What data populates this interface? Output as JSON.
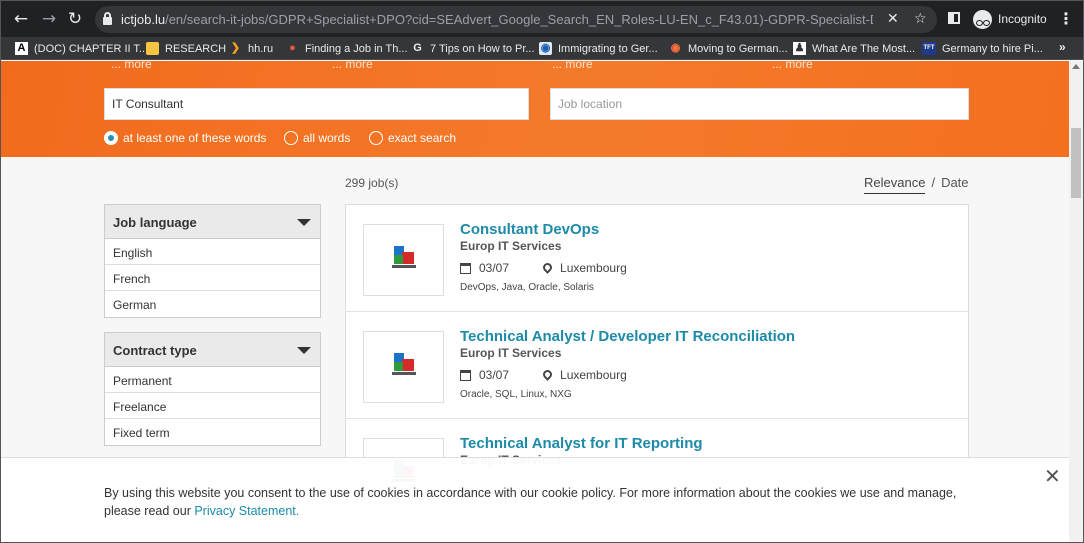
{
  "browser": {
    "url_host": "ictjob.lu",
    "url_path": "/en/search-it-jobs/GDPR+Specialist+DPO?cid=SEAdvert_Google_Search_EN_Roles-LU-EN_c_F43.01)-GDPR-Specialist-DPO\\_luxembour...",
    "profile_label": "Incognito"
  },
  "bookmarks": [
    {
      "label": "(DOC) CHAPTER II T...",
      "icon": "A"
    },
    {
      "label": "RESEARCH",
      "icon": "folder"
    },
    {
      "label": "hh.ru",
      "icon": "hh"
    },
    {
      "label": "Finding a Job in Th...",
      "icon": "globe"
    },
    {
      "label": "7 Tips on How to Pr...",
      "icon": "G"
    },
    {
      "label": "Immigrating to Ger...",
      "icon": "globe"
    },
    {
      "label": "Moving to German...",
      "icon": "firefox"
    },
    {
      "label": "What Are The Most...",
      "icon": "person"
    },
    {
      "label": "Germany to hire Pi...",
      "icon": "TFT"
    }
  ],
  "search": {
    "more_links": [
      "... more",
      "... more",
      "... more",
      "... more"
    ],
    "keyword_value": "IT Consultant",
    "location_placeholder": "Job location",
    "options": [
      {
        "label": "at least one of these words",
        "checked": true
      },
      {
        "label": "all words",
        "checked": false
      },
      {
        "label": "exact search",
        "checked": false
      }
    ]
  },
  "results": {
    "count": "299 job(s)",
    "sort_relevance": "Relevance",
    "sort_separator": "/",
    "sort_date": "Date"
  },
  "filters": [
    {
      "title": "Job language",
      "items": [
        "English",
        "French",
        "German"
      ]
    },
    {
      "title": "Contract type",
      "items": [
        "Permanent",
        "Freelance",
        "Fixed term"
      ]
    }
  ],
  "jobs": [
    {
      "title": "Consultant DevOps",
      "company": "Europ IT Services",
      "date": "03/07",
      "location": "Luxembourg",
      "tags": "DevOps, Java, Oracle, Solaris"
    },
    {
      "title": "Technical Analyst / Developer IT Reconciliation",
      "company": "Europ IT Services",
      "date": "03/07",
      "location": "Luxembourg",
      "tags": "Oracle, SQL, Linux, NXG"
    },
    {
      "title": "Technical Analyst for IT Reporting",
      "company": "Europ IT Services",
      "date": "",
      "location": "",
      "tags": ""
    }
  ],
  "cookie": {
    "text": "By using this website you consent to the use of cookies in accordance with our cookie policy. For more information about the cookies we use and manage, please read our ",
    "link": "Privacy Statement."
  },
  "colors": {
    "accent_orange": "#f26b1d",
    "link_teal": "#1c8aa8",
    "chrome_dark": "#202124"
  }
}
